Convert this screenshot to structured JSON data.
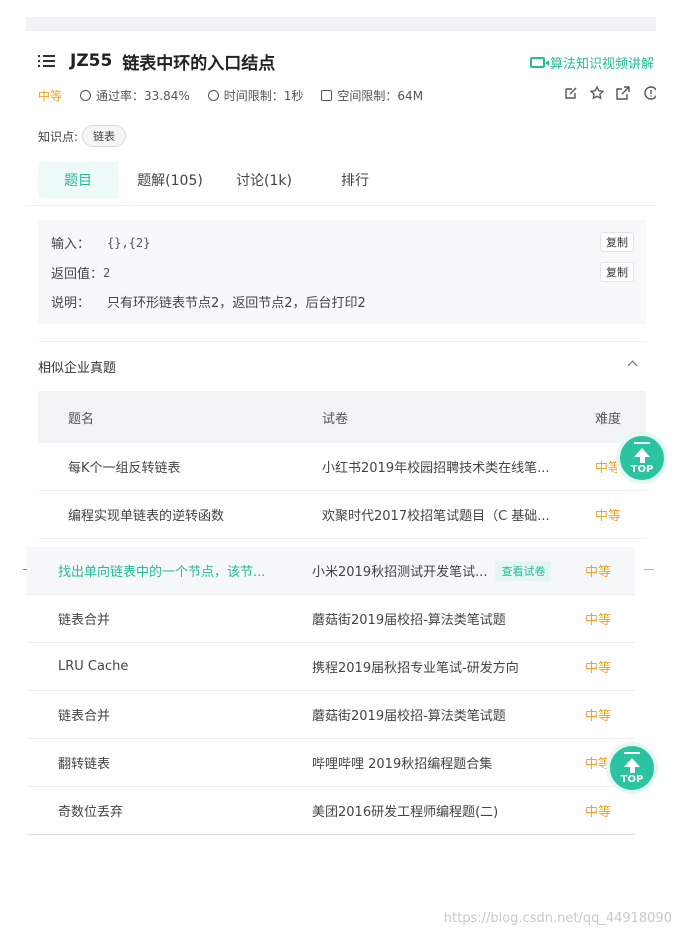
{
  "header": {
    "title_code": "JZ55",
    "title": "链表中环的入口结点",
    "video_link": "算法知识视频讲解"
  },
  "meta": {
    "difficulty": "中等",
    "pass_rate": "通过率：33.84%",
    "time_limit": "时间限制：1秒",
    "space_limit": "空间限制：64M"
  },
  "tags": {
    "label": "知识点:",
    "items": [
      "链表"
    ]
  },
  "tabs": [
    {
      "label": "题目",
      "active": true
    },
    {
      "label": "题解(105)"
    },
    {
      "label": "讨论(1k)"
    },
    {
      "label": "排行"
    }
  ],
  "example": {
    "input_label": "输入：",
    "input_value": "{},{2}",
    "output_label": "返回值：",
    "output_value": "2",
    "desc_label": "说明：",
    "desc_value": "只有环形链表节点2，返回节点2，后台打印2",
    "copy_label": "复制"
  },
  "similar": {
    "title": "相似企业真题",
    "columns": [
      "题名",
      "试卷",
      "难度"
    ],
    "rows": [
      {
        "name": "每K个一组反转链表",
        "paper": "小红书2019年校园招聘技术类在线笔...",
        "difficulty": "中等"
      },
      {
        "name": "编程实现单链表的逆转函数",
        "paper": "欢聚时代2017校招笔试题目（C 基础...",
        "difficulty": "中等"
      },
      {
        "name": "找出单向链表中的一个节点，该节...",
        "paper": "小米2019秋招测试开发笔试...",
        "difficulty": "中等",
        "view": "查看试卷"
      },
      {
        "name": "链表合并",
        "paper": "蘑菇街2019届校招-算法类笔试题",
        "difficulty": "中等"
      },
      {
        "name": "LRU Cache",
        "paper": "携程2019届秋招专业笔试-研发方向",
        "difficulty": "中等"
      },
      {
        "name": "链表合并",
        "paper": "蘑菇街2019届校招-算法类笔试题",
        "difficulty": "中等"
      },
      {
        "name": "翻转链表",
        "paper": "哔哩哔哩 2019秋招编程题合集",
        "difficulty": "中等"
      },
      {
        "name": "奇数位丢弃",
        "paper": "美团2016研发工程师编程题(二)",
        "difficulty": "中等"
      }
    ]
  },
  "top_button": "TOP",
  "watermark": "https://blog.csdn.net/qq_44918090",
  "colors": {
    "accent": "#25bb9b",
    "difficulty": "#f0a51e"
  }
}
